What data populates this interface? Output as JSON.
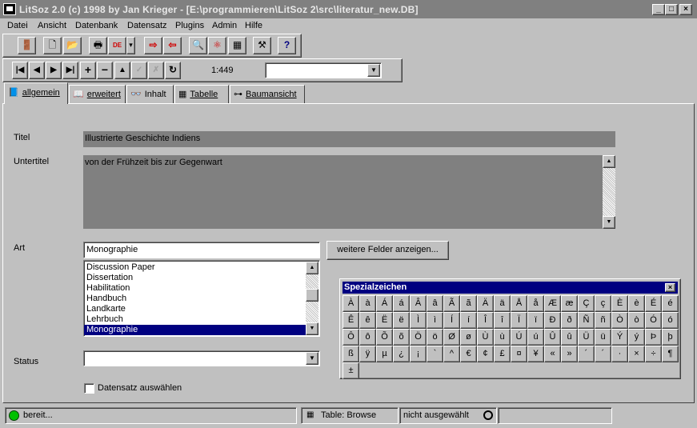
{
  "window": {
    "title": "LitSoz 2.0    (c) 1998 by Jan Krieger  - [E:\\programmieren\\LitSoz 2\\src\\literatur_new.DB]",
    "min": "_",
    "max": "□",
    "close": "×"
  },
  "menu": [
    {
      "label": "Datei"
    },
    {
      "label": "Ansicht"
    },
    {
      "label": "Datenbank"
    },
    {
      "label": "Datensatz"
    },
    {
      "label": "Plugins"
    },
    {
      "label": "Admin"
    },
    {
      "label": "Hilfe"
    }
  ],
  "toolbar": {
    "exit": "🚪",
    "new": "🗋",
    "open": "📂",
    "print": "🖶",
    "lang": "DE",
    "lang_arrow": "▾",
    "export": "⇨",
    "import": "⇦",
    "preview": "🔍",
    "convert": "⚛",
    "calc": "▦",
    "tools": "⚒",
    "help": "?"
  },
  "nav": {
    "first": "|◀",
    "prev": "◀",
    "next": "▶",
    "last": "▶|",
    "add": "+",
    "delete": "−",
    "up": "▲",
    "post": "✓",
    "cancel": "✗",
    "refresh": "↻",
    "position": "1:449",
    "combo_value": ""
  },
  "tabs": [
    {
      "label": "allgemein",
      "icon": "📘"
    },
    {
      "label": "erweitert",
      "icon": "📖"
    },
    {
      "label": "Inhalt",
      "icon": "👓"
    },
    {
      "label": "Tabelle",
      "icon": "▦"
    },
    {
      "label": "Baumansicht",
      "icon": "⊶"
    }
  ],
  "form": {
    "titel_label": "Titel",
    "titel_value": "Illustrierte Geschichte  Indiens",
    "untertitel_label": "Untertitel",
    "untertitel_value": "von der Frühzeit bis zur Gegenwart",
    "art_label": "Art",
    "art_value": "Monographie",
    "more_fields": "weitere Felder anzeigen...",
    "art_list": [
      "Discussion Paper",
      "Dissertation",
      "Habilitation",
      "Handbuch",
      "Landkarte",
      "Lehrbuch",
      "Monographie"
    ],
    "art_selected": "Monographie",
    "status_label": "Status",
    "status_value": "",
    "select_label": "Datensatz auswählen"
  },
  "spezialzeichen": {
    "title": "Spezialzeichen",
    "close": "×",
    "chars": [
      "À",
      "à",
      "Á",
      "á",
      "Â",
      "â",
      "Ã",
      "ã",
      "Ä",
      "ä",
      "Å",
      "å",
      "Æ",
      "æ",
      "Ç",
      "ç",
      "È",
      "è",
      "É",
      "é",
      "Ê",
      "ê",
      "Ë",
      "ë",
      "Ì",
      "ì",
      "Í",
      "í",
      "Î",
      "î",
      "Ï",
      "ï",
      "Ð",
      "ð",
      "Ñ",
      "ñ",
      "Ò",
      "ò",
      "Ó",
      "ó",
      "Ô",
      "ô",
      "Õ",
      "õ",
      "Ö",
      "ö",
      "Ø",
      "ø",
      "Ù",
      "ù",
      "Ú",
      "ú",
      "Û",
      "û",
      "Ü",
      "ü",
      "Ý",
      "ý",
      "Þ",
      "þ",
      "ß",
      "ÿ",
      "µ",
      "¿",
      "¡",
      "`",
      "^",
      "€",
      "¢",
      "£",
      "¤",
      "¥",
      "«",
      "»",
      "´",
      "´",
      "·",
      "×",
      "÷",
      "¶",
      "±"
    ]
  },
  "status": {
    "state": "bereit...",
    "table": "Table: Browse",
    "selection": "nicht ausgewählt",
    "status_color": "#00c000"
  }
}
